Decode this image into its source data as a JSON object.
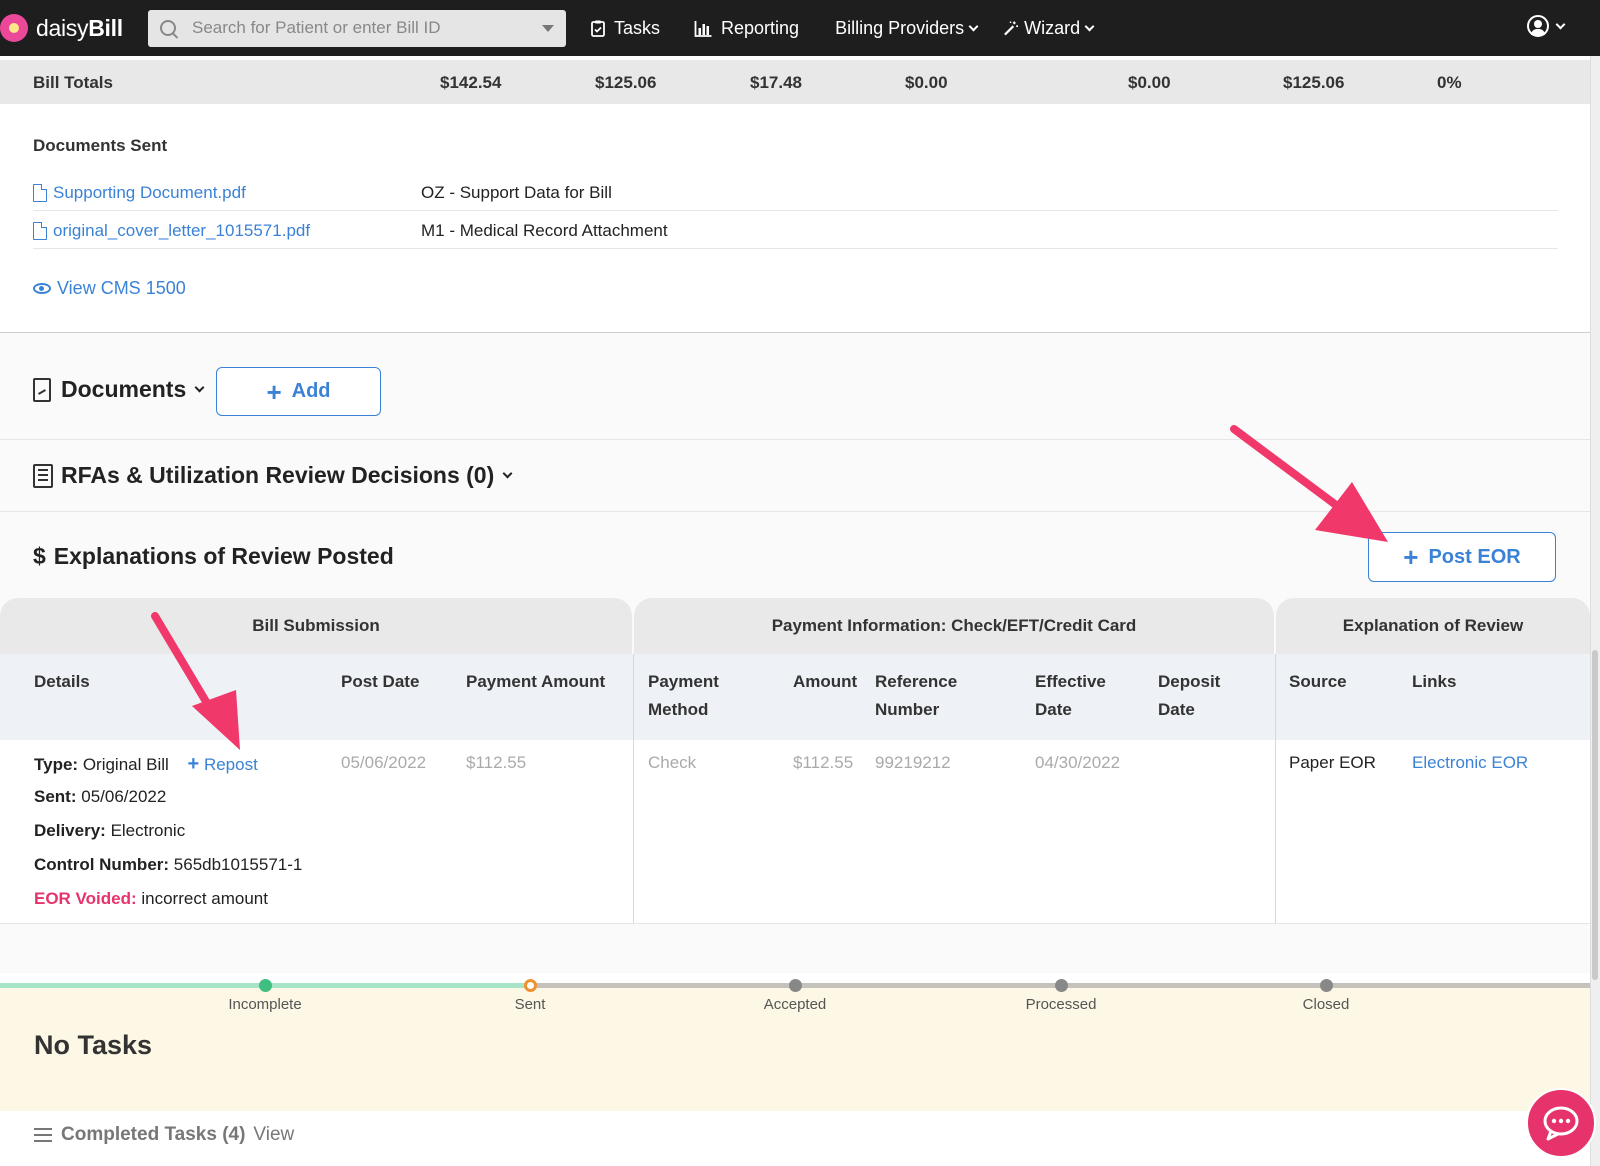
{
  "colors": {
    "accent": "#3b82d6",
    "nav_bg": "#1e1e1e",
    "void_red": "#e6336b",
    "arrow_pink": "#f0386b"
  },
  "nav": {
    "logo_daisy": "daisy",
    "logo_bill": "Bill",
    "search_placeholder": "Search for Patient or enter Bill ID",
    "items": [
      {
        "label": "Tasks",
        "icon": "clipboard-check-icon"
      },
      {
        "label": "Reporting",
        "icon": "bar-chart-icon"
      },
      {
        "label": "Billing Providers",
        "icon": "chevron-down-icon"
      },
      {
        "label": "Wizard",
        "icon": "magic-wand-icon"
      }
    ]
  },
  "totals": {
    "label": "Bill Totals",
    "values": [
      "$142.54",
      "$125.06",
      "$17.48",
      "$0.00",
      "$0.00",
      "$125.06",
      "0%"
    ]
  },
  "documents_sent": {
    "title": "Documents Sent",
    "rows": [
      {
        "file": "Supporting Document.pdf",
        "desc": "OZ - Support Data for Bill"
      },
      {
        "file": "original_cover_letter_1015571.pdf",
        "desc": "M1 - Medical Record Attachment"
      }
    ],
    "view_cms": "View CMS 1500"
  },
  "documents": {
    "title": "Documents",
    "add_label": "Add"
  },
  "rfa": {
    "title": "RFAs & Utilization Review Decisions (0)"
  },
  "eor": {
    "title": "Explanations of Review Posted",
    "post_label": "Post EOR",
    "groups": [
      "Bill Submission",
      "Payment Information: Check/EFT/Credit Card",
      "Explanation of Review"
    ],
    "headers": {
      "details": "Details",
      "post_date": "Post Date",
      "payment_amount": "Payment Amount",
      "payment_method_1": "Payment",
      "payment_method_2": "Method",
      "amount": "Amount",
      "reference_1": "Reference",
      "reference_2": "Number",
      "effective_1": "Effective",
      "effective_2": "Date",
      "deposit_1": "Deposit",
      "deposit_2": "Date",
      "source": "Source",
      "links": "Links"
    },
    "row": {
      "type_label": "Type:",
      "type_value": "Original Bill",
      "repost_label": "Repost",
      "sent_label": "Sent:",
      "sent_value": "05/06/2022",
      "delivery_label": "Delivery:",
      "delivery_value": "Electronic",
      "control_label": "Control Number:",
      "control_value": "565db1015571-1",
      "void_label": "EOR Voided:",
      "void_value": "incorrect amount",
      "post_date": "05/06/2022",
      "payment_amount": "$112.55",
      "payment_method": "Check",
      "amount": "$112.55",
      "reference": "99219212",
      "effective_date": "04/30/2022",
      "source": "Paper EOR",
      "link": "Electronic EOR"
    }
  },
  "progress": {
    "steps": [
      "Incomplete",
      "Sent",
      "Accepted",
      "Processed",
      "Closed"
    ]
  },
  "tasks": {
    "no_tasks": "No Tasks",
    "completed_label": "Completed Tasks (4)",
    "view_label": "View"
  }
}
